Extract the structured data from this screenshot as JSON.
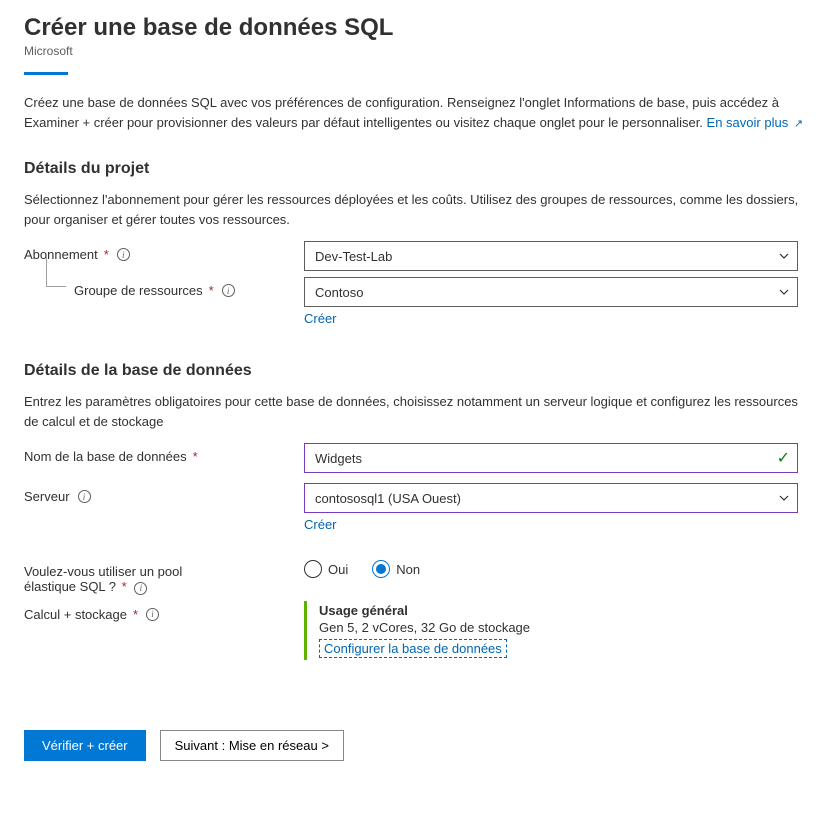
{
  "header": {
    "title": "Créer une base de données SQL",
    "publisher": "Microsoft"
  },
  "intro": {
    "text": "Créez une base de données SQL avec vos préférences de configuration. Renseignez l'onglet Informations de base, puis accédez à Examiner + créer pour provisionner des valeurs par défaut intelligentes ou visitez chaque onglet pour le personnaliser. ",
    "learn_more": "En savoir plus"
  },
  "project": {
    "heading": "Détails du projet",
    "desc": "Sélectionnez l'abonnement pour gérer les ressources déployées et les coûts. Utilisez des groupes de ressources, comme les dossiers, pour organiser et gérer toutes vos ressources.",
    "subscription_label": "Abonnement",
    "subscription_value": "Dev-Test-Lab",
    "rg_label": "Groupe de ressources",
    "rg_value": "Contoso",
    "create_link": "Créer"
  },
  "db": {
    "heading": "Détails de la base de données",
    "desc": "Entrez les paramètres obligatoires pour cette base de données, choisissez notamment un serveur logique et configurez les ressources de calcul et de stockage",
    "name_label": "Nom de la base de données",
    "name_value": "Widgets",
    "server_label": "Serveur",
    "server_value": "contososql1 (USA Ouest)",
    "create_link": "Créer",
    "pool_label_line1": "Voulez-vous utiliser un pool",
    "pool_label_line2": "élastique SQL ?",
    "radio_yes": "Oui",
    "radio_no": "Non",
    "compute_label": "Calcul + stockage",
    "compute_title": "Usage général",
    "compute_detail": "Gen 5, 2 vCores, 32 Go de stockage",
    "configure_link": "Configurer la base de données"
  },
  "footer": {
    "review": "Vérifier + créer",
    "next": "Suivant : Mise en réseau >"
  }
}
